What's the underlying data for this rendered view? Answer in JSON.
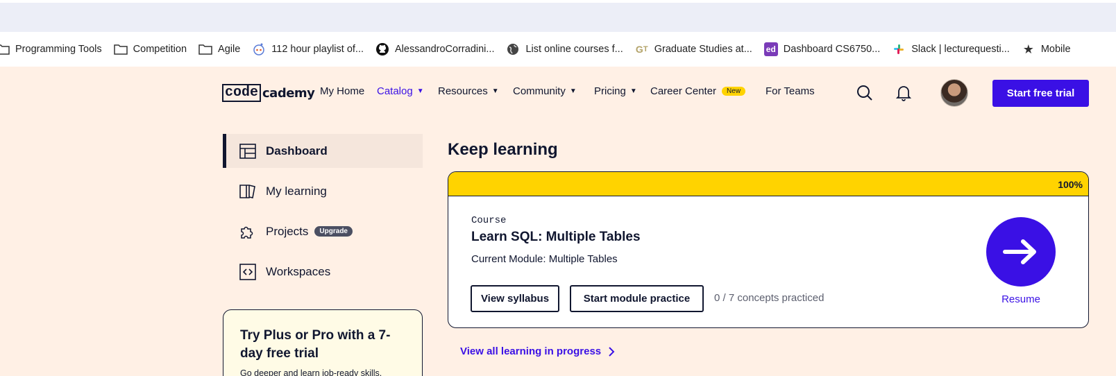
{
  "bookmarks": [
    {
      "label": "Programming Tools",
      "icon": "folder-icon"
    },
    {
      "label": "Competition",
      "icon": "folder-icon"
    },
    {
      "label": "Agile",
      "icon": "folder-icon"
    },
    {
      "label": "112 hour playlist of...",
      "icon": "reddit-icon"
    },
    {
      "label": "AlessandroCorradini...",
      "icon": "github-icon"
    },
    {
      "label": "List online courses f...",
      "icon": "globe-icon"
    },
    {
      "label": "Graduate Studies at...",
      "icon": "gt-icon"
    },
    {
      "label": "Dashboard CS6750...",
      "icon": "ed-icon"
    },
    {
      "label": "Slack | lecturequesti...",
      "icon": "slack-icon"
    },
    {
      "label": "Mobile",
      "icon": "star-icon"
    }
  ],
  "header": {
    "logo_boxed": "code",
    "logo_rest": "cademy",
    "nav": {
      "my_home": "My Home",
      "catalog": "Catalog",
      "resources": "Resources",
      "community": "Community",
      "pricing": "Pricing",
      "career_center": "Career Center",
      "new_badge": "New",
      "for_teams": "For Teams"
    },
    "cta": "Start free trial"
  },
  "sidebar": {
    "items": [
      {
        "label": "Dashboard",
        "icon": "dashboard-icon"
      },
      {
        "label": "My learning",
        "icon": "book-icon"
      },
      {
        "label": "Projects",
        "icon": "puzzle-icon"
      },
      {
        "label": "Workspaces",
        "icon": "code-icon"
      }
    ],
    "upgrade_badge": "Upgrade",
    "promo_title": "Try Plus or Pro with a 7-day free trial",
    "promo_text": "Go deeper and learn job-ready skills."
  },
  "main": {
    "heading": "Keep learning",
    "progress": "100%",
    "course_kind": "Course",
    "course_title": "Learn SQL: Multiple Tables",
    "current_module": "Current Module: Multiple Tables",
    "view_syllabus": "View syllabus",
    "start_practice": "Start module practice",
    "concepts": "0 / 7 concepts practiced",
    "resume": "Resume",
    "view_all": "View all learning in progress"
  },
  "colors": {
    "accent": "#3a10e5",
    "progress_bar": "#ffd300",
    "background": "#fff0e5",
    "ink": "#10162f"
  }
}
